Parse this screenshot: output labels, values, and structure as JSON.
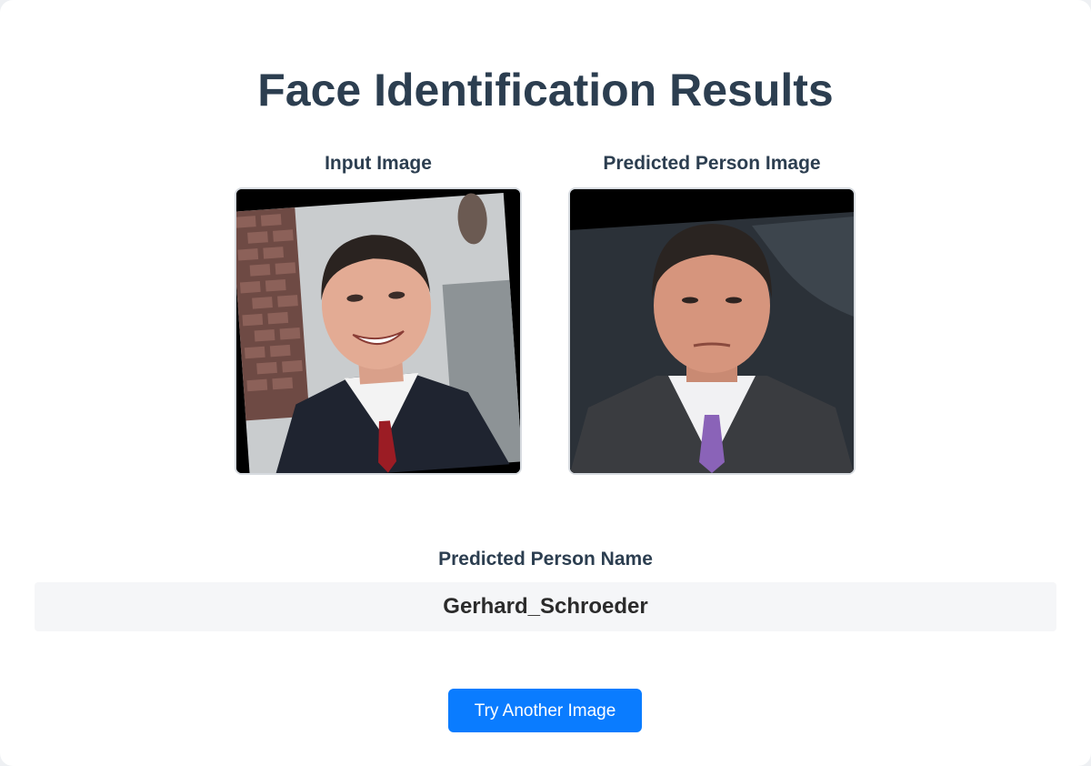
{
  "page": {
    "title": "Face Identification Results"
  },
  "input_image": {
    "label": "Input Image"
  },
  "predicted_image": {
    "label": "Predicted Person Image"
  },
  "prediction": {
    "label": "Predicted Person Name",
    "name": "Gerhard_Schroeder"
  },
  "actions": {
    "try_again_label": "Try Another Image"
  },
  "colors": {
    "title": "#2c3e50",
    "button": "#0a7cff",
    "name_box": "#f5f6f8"
  }
}
